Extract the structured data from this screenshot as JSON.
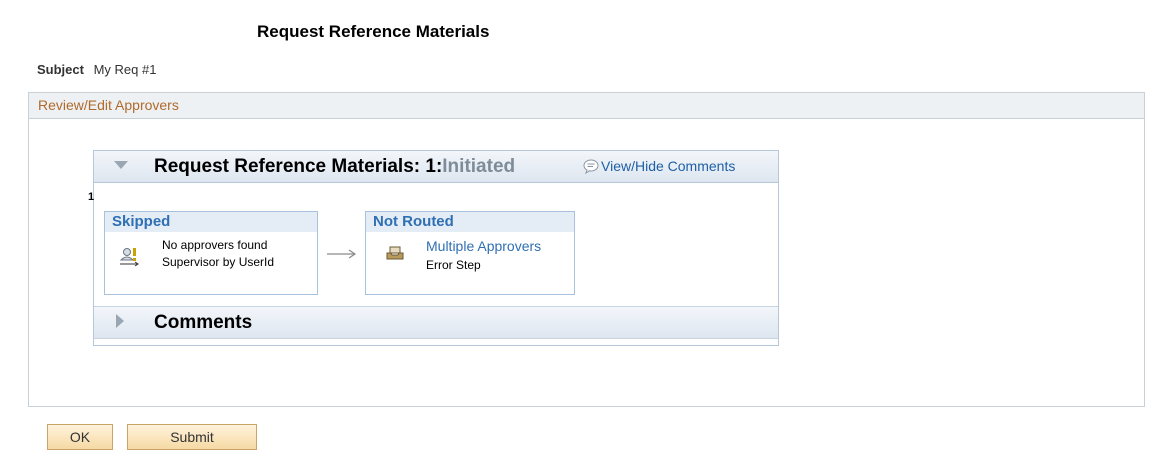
{
  "page": {
    "title": "Request Reference Materials",
    "subject_label": "Subject",
    "subject_value": "My Req #1"
  },
  "review": {
    "header": "Review/Edit Approvers"
  },
  "flow": {
    "title": "Request Reference Materials: 1:",
    "status": "Initiated",
    "comments_link": "View/Hide Comments",
    "step_number": "1",
    "steps": [
      {
        "status": "Skipped",
        "line1": "No approvers found",
        "line2": "Supervisor by UserId",
        "icon": "user-warning-icon"
      },
      {
        "status": "Not Routed",
        "line1": "Multiple Approvers",
        "line2": "Error Step",
        "icon": "inbox-tray-icon"
      }
    ],
    "comments_label": "Comments"
  },
  "buttons": {
    "ok": "OK",
    "submit": "Submit"
  },
  "colors": {
    "link": "#1f5fa6",
    "section_header_text": "#b06a2c",
    "button_bg": "#f6d9a4"
  }
}
